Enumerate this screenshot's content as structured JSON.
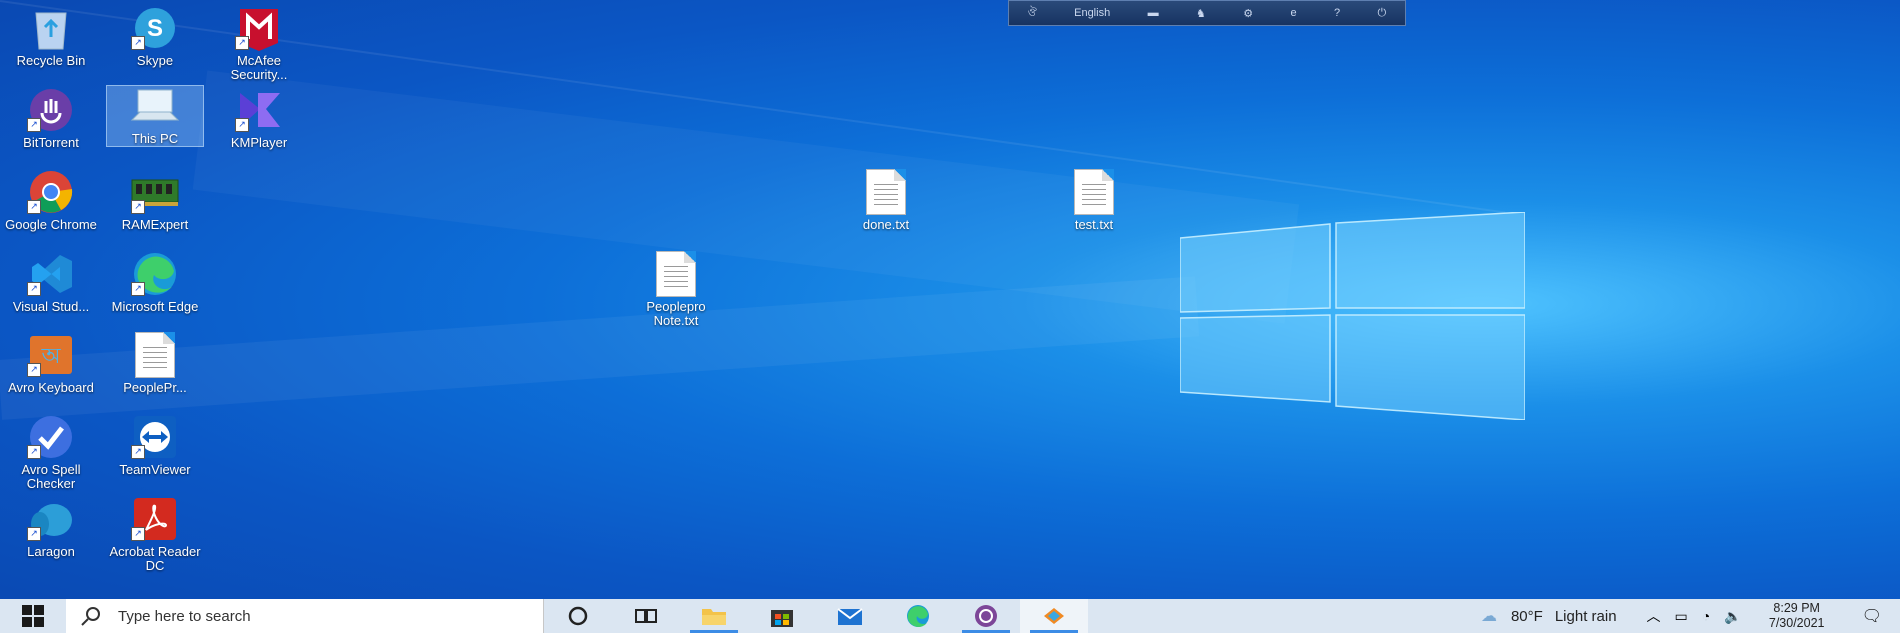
{
  "language_bar": {
    "language_label": "English",
    "icons": [
      "avro-logo-icon",
      "keyboard-layout-icon",
      "mouse-icon",
      "settings-icon",
      "edge-icon",
      "help-icon",
      "power-icon"
    ]
  },
  "desktop_icons": [
    {
      "label": "Recycle Bin",
      "icon": "recycle-bin-icon"
    },
    {
      "label": "Skype",
      "icon": "skype-icon"
    },
    {
      "label": "McAfee Security...",
      "icon": "mcafee-icon"
    },
    {
      "label": "BitTorrent",
      "icon": "bittorrent-icon"
    },
    {
      "label": "This PC",
      "icon": "this-pc-icon"
    },
    {
      "label": "KMPlayer",
      "icon": "kmplayer-icon"
    },
    {
      "label": "Google Chrome",
      "icon": "chrome-icon"
    },
    {
      "label": "RAMExpert",
      "icon": "ramexpert-icon"
    },
    {
      "label": "Visual Stud...",
      "icon": "visual-studio-code-icon"
    },
    {
      "label": "Microsoft Edge",
      "icon": "edge-icon"
    },
    {
      "label": "Avro Keyboard",
      "icon": "avro-keyboard-icon"
    },
    {
      "label": "PeoplePr...",
      "icon": "text-document-icon"
    },
    {
      "label": "Avro Spell Checker",
      "icon": "spell-checker-icon"
    },
    {
      "label": "TeamViewer",
      "icon": "teamviewer-icon"
    },
    {
      "label": "Laragon",
      "icon": "laragon-icon"
    },
    {
      "label": "Acrobat Reader DC",
      "icon": "acrobat-reader-icon"
    }
  ],
  "desktop_files": [
    {
      "label": "done.txt"
    },
    {
      "label": "test.txt"
    },
    {
      "label": "Peoplepro Note.txt"
    }
  ],
  "taskbar": {
    "search_placeholder": "Type here to search",
    "pinned": [
      "cortana-icon",
      "task-view-icon",
      "file-explorer-icon",
      "microsoft-store-icon",
      "mail-icon",
      "edge-icon",
      "tor-browser-icon",
      "app-icon"
    ],
    "weather_temp": "80°F",
    "weather_desc": "Light rain",
    "time": "8:29 PM",
    "date": "7/30/2021"
  },
  "colors": {
    "taskbar": "#dbe6f2",
    "accent": "#3c8ce6",
    "desktop": "#0b6ad6"
  }
}
